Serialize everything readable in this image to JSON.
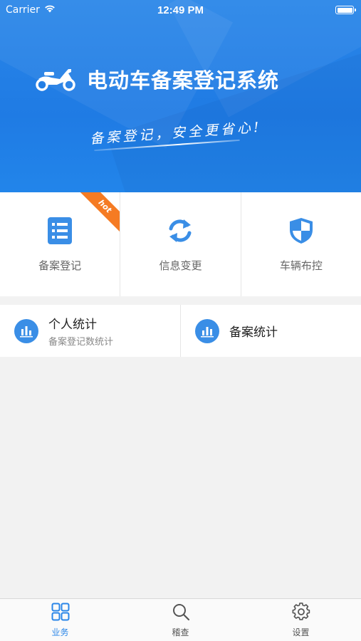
{
  "status_bar": {
    "carrier": "Carrier",
    "time": "12:49 PM"
  },
  "header": {
    "title": "电动车备案登记系统",
    "slogan": "备案登记，安全更省心!"
  },
  "grid": [
    {
      "label": "备案登记",
      "icon": "document-list-icon",
      "badge": "hot"
    },
    {
      "label": "信息变更",
      "icon": "refresh-arrows-icon"
    },
    {
      "label": "车辆布控",
      "icon": "shield-icon"
    }
  ],
  "stats": [
    {
      "title": "个人统计",
      "subtitle": "备案登记数统计",
      "icon": "bar-chart-icon"
    },
    {
      "title": "备案统计",
      "icon": "bar-chart-icon"
    }
  ],
  "tabbar": [
    {
      "label": "业务",
      "icon": "grid-icon",
      "active": true
    },
    {
      "label": "稽查",
      "icon": "search-icon"
    },
    {
      "label": "设置",
      "icon": "gear-icon"
    }
  ],
  "colors": {
    "accent": "#2a86e8",
    "hot": "#f57b23",
    "background": "#f2f2f2"
  }
}
